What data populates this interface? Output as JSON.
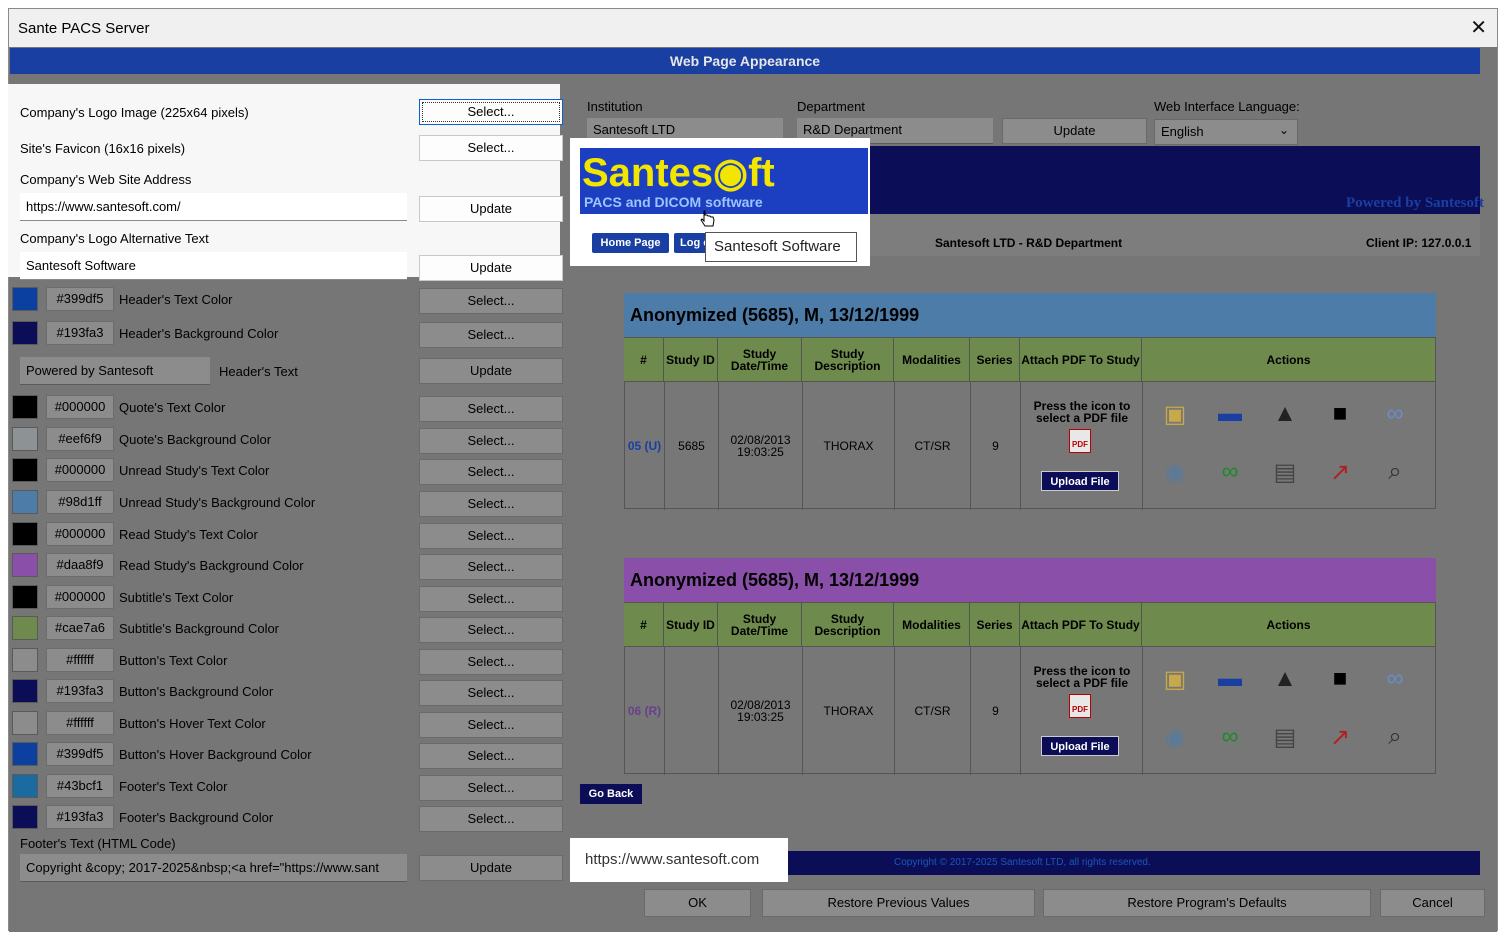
{
  "window": {
    "title": "Sante PACS Server",
    "close": "✕"
  },
  "section_title": "Web Page Appearance",
  "logo_row": {
    "label": "Company's Logo Image (225x64 pixels)",
    "button": "Select..."
  },
  "favicon_row": {
    "label": "Site's Favicon (16x16 pixels)",
    "button": "Select..."
  },
  "website": {
    "label": "Company's Web Site Address",
    "value": "https://www.santesoft.com/",
    "button": "Update"
  },
  "alt_text": {
    "label": "Company's Logo Alternative Text",
    "value": "Santesoft Software",
    "button": "Update"
  },
  "colors": [
    {
      "hex": "#399df5",
      "label": "Header's Text Color",
      "swatch": "#0b3fa0",
      "button": "Select..."
    },
    {
      "hex": "#193fa3",
      "label": "Header's Background Color",
      "swatch": "#0b0e57",
      "button": "Select..."
    }
  ],
  "header_text": {
    "value": "Powered by Santesoft",
    "label": "Header's Text",
    "button": "Update"
  },
  "colors2": [
    {
      "hex": "#000000",
      "label": "Quote's Text Color",
      "swatch": "#000000",
      "button": "Select..."
    },
    {
      "hex": "#eef6f9",
      "label": "Quote's Background Color",
      "swatch": "#8d9294",
      "button": "Select..."
    },
    {
      "hex": "#000000",
      "label": "Unread Study's Text Color",
      "swatch": "#000000",
      "button": "Select..."
    },
    {
      "hex": "#98d1ff",
      "label": "Unread Study's Background Color",
      "swatch": "#4d7ca8",
      "button": "Select..."
    },
    {
      "hex": "#000000",
      "label": "Read Study's Text Color",
      "swatch": "#000000",
      "button": "Select..."
    },
    {
      "hex": "#daa8f9",
      "label": "Read Study's Background Color",
      "swatch": "#8a4fa8",
      "button": "Select..."
    },
    {
      "hex": "#000000",
      "label": "Subtitle's Text Color",
      "swatch": "#000000",
      "button": "Select..."
    },
    {
      "hex": "#cae7a6",
      "label": "Subtitle's Background Color",
      "swatch": "#6e8a4d",
      "button": "Select..."
    },
    {
      "hex": "#ffffff",
      "label": "Button's Text Color",
      "swatch": "#8c8c8c",
      "button": "Select..."
    },
    {
      "hex": "#193fa3",
      "label": "Button's Background Color",
      "swatch": "#0b0e57",
      "button": "Select..."
    },
    {
      "hex": "#ffffff",
      "label": "Button's Hover Text Color",
      "swatch": "#8c8c8c",
      "button": "Select..."
    },
    {
      "hex": "#399df5",
      "label": "Button's Hover Background Color",
      "swatch": "#0b3fa0",
      "button": "Select..."
    },
    {
      "hex": "#43bcf1",
      "label": "Footer's Text Color",
      "swatch": "#1b6aa0",
      "button": "Select..."
    },
    {
      "hex": "#193fa3",
      "label": "Footer's Background Color",
      "swatch": "#0b0e57",
      "button": "Select..."
    }
  ],
  "footer_html": {
    "label": "Footer's Text (HTML Code)",
    "value": "Copyright &copy; 2017-2025&nbsp;<a href=\"https://www.sant",
    "button": "Update"
  },
  "institution": {
    "label": "Institution",
    "value": "Santesoft LTD"
  },
  "department": {
    "label": "Department",
    "value": "R&D Department"
  },
  "update_button": "Update",
  "language": {
    "label": "Web Interface Language:",
    "value": "English"
  },
  "preview": {
    "logo_main": "Santes◉ft",
    "logo_sub": "PACS and DICOM software",
    "powered": "Powered by Santesoft",
    "home_button": "Home Page",
    "logout_button": "Log o",
    "tooltip": "Santesoft Software",
    "center_text": "Santesoft LTD - R&D Department",
    "client_ip": "Client IP: 127.0.0.1",
    "columns": [
      "#",
      "Study ID",
      "Study Date/Time",
      "Study Description",
      "Modalities",
      "Series",
      "Attach PDF To Study",
      "Actions"
    ],
    "studies": [
      {
        "title": "Anonymized (5685), M, 13/12/1999",
        "num": "05 (U)",
        "id": "5685",
        "datetime": "02/08/2013 19:03:25",
        "desc": "THORAX",
        "modalities": "CT/SR",
        "series": "9",
        "pdf_text": "Press the icon to select a PDF file",
        "upload": "Upload File",
        "head_color": "#4d7ca8",
        "num_color": "#193fa3"
      },
      {
        "title": "Anonymized (5685), M, 13/12/1999",
        "num": "06 (R)",
        "id": "",
        "datetime": "02/08/2013 19:03:25",
        "desc": "THORAX",
        "modalities": "CT/SR",
        "series": "9",
        "pdf_text": "Press the icon to select a PDF file",
        "upload": "Upload File",
        "head_color": "#8a4fa8",
        "num_color": "#6a3f8a"
      }
    ],
    "go_back": "Go Back",
    "footer_copyright": "Copyright © 2017-2025 Santesoft LTD, all rights reserved.",
    "status_url": "https://www.santesoft.com"
  },
  "bottom": {
    "ok": "OK",
    "restore_prev": "Restore Previous Values",
    "restore_defaults": "Restore Program's Defaults",
    "cancel": "Cancel"
  }
}
